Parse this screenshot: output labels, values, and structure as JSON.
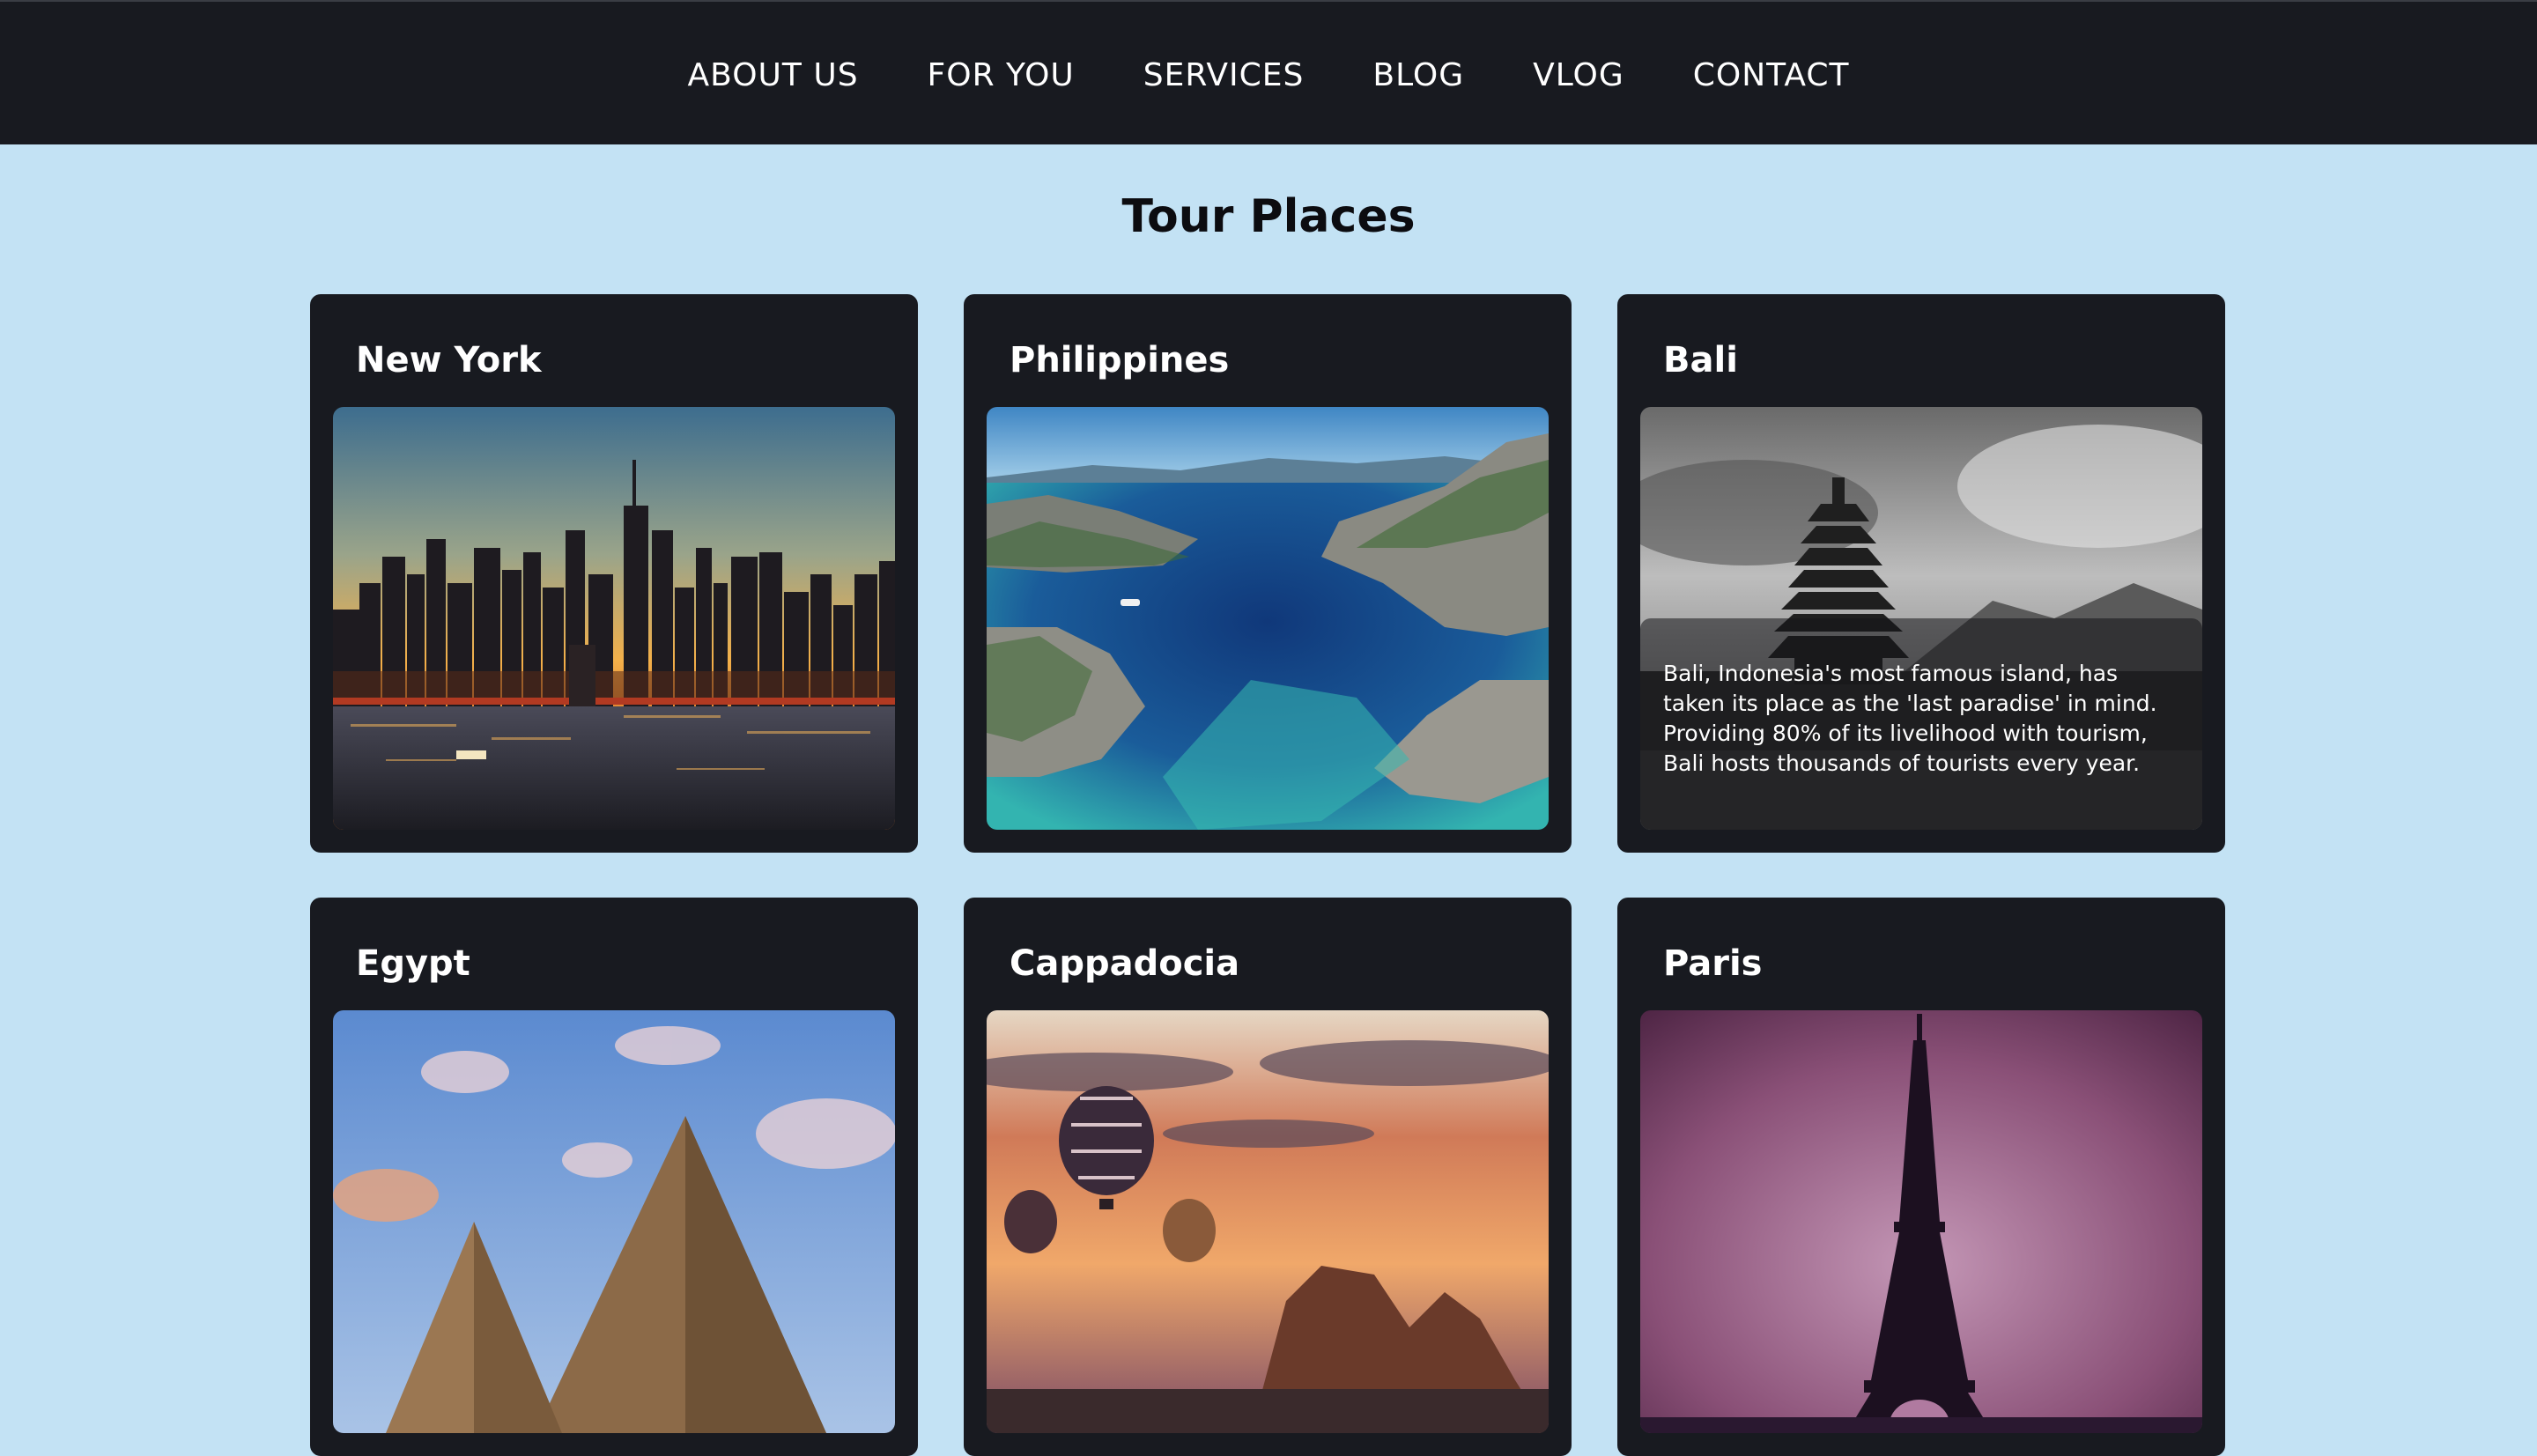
{
  "nav": {
    "items": [
      {
        "label": "ABOUT US"
      },
      {
        "label": "FOR YOU"
      },
      {
        "label": "SERVICES"
      },
      {
        "label": "BLOG"
      },
      {
        "label": "VLOG"
      },
      {
        "label": "CONTACT"
      }
    ]
  },
  "page": {
    "title": "Tour Places"
  },
  "cards": [
    {
      "name": "New York"
    },
    {
      "name": "Philippines"
    },
    {
      "name": "Bali",
      "description": "Bali, Indonesia's most famous island, has taken its place as the 'last paradise' in mind. Providing 80% of its livelihood with tourism, Bali hosts thousands of tourists every year."
    },
    {
      "name": "Egypt"
    },
    {
      "name": "Cappadocia"
    },
    {
      "name": "Paris"
    }
  ],
  "colors": {
    "background": "#c3e2f4",
    "nav": "#181a20",
    "card": "#181a20",
    "text_light": "#ffffff",
    "text_dark": "#0c0c10"
  }
}
